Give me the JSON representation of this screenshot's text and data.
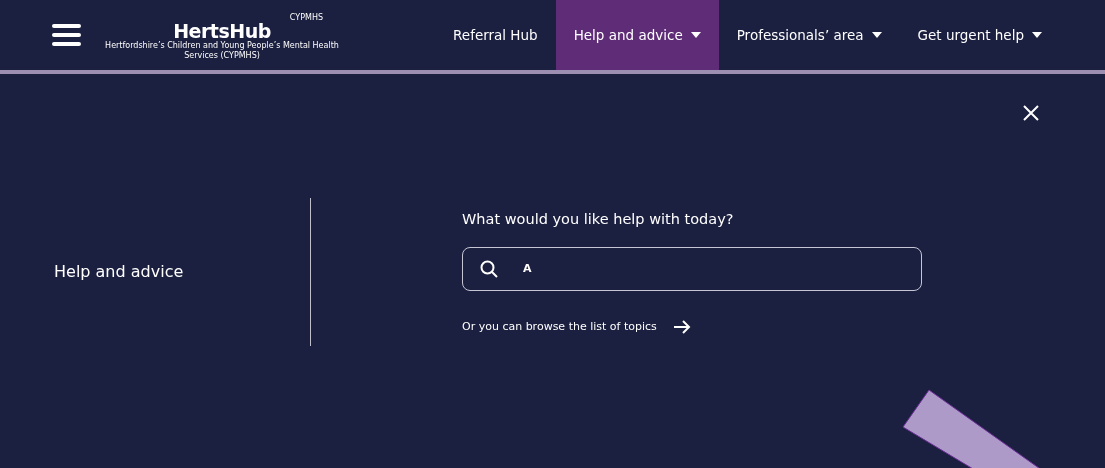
{
  "logo": {
    "overline": "CYPMHS",
    "name": "HertsHub",
    "tagline": "Hertfordshire’s Children and Young People’s Mental Health Services (CYPMHS)"
  },
  "nav": [
    {
      "label": "Referral Hub",
      "dropdown": false,
      "selected": false
    },
    {
      "label": "Help and advice",
      "dropdown": true,
      "selected": true
    },
    {
      "label": "Professionals’ area",
      "dropdown": true,
      "selected": false
    },
    {
      "label": "Get urgent help",
      "dropdown": true,
      "selected": false
    }
  ],
  "panel": {
    "title": "Help and advice",
    "question": "What would you like help with today?",
    "search": {
      "value": "A"
    },
    "browse_link": "Or you can browse the list of topics"
  }
}
